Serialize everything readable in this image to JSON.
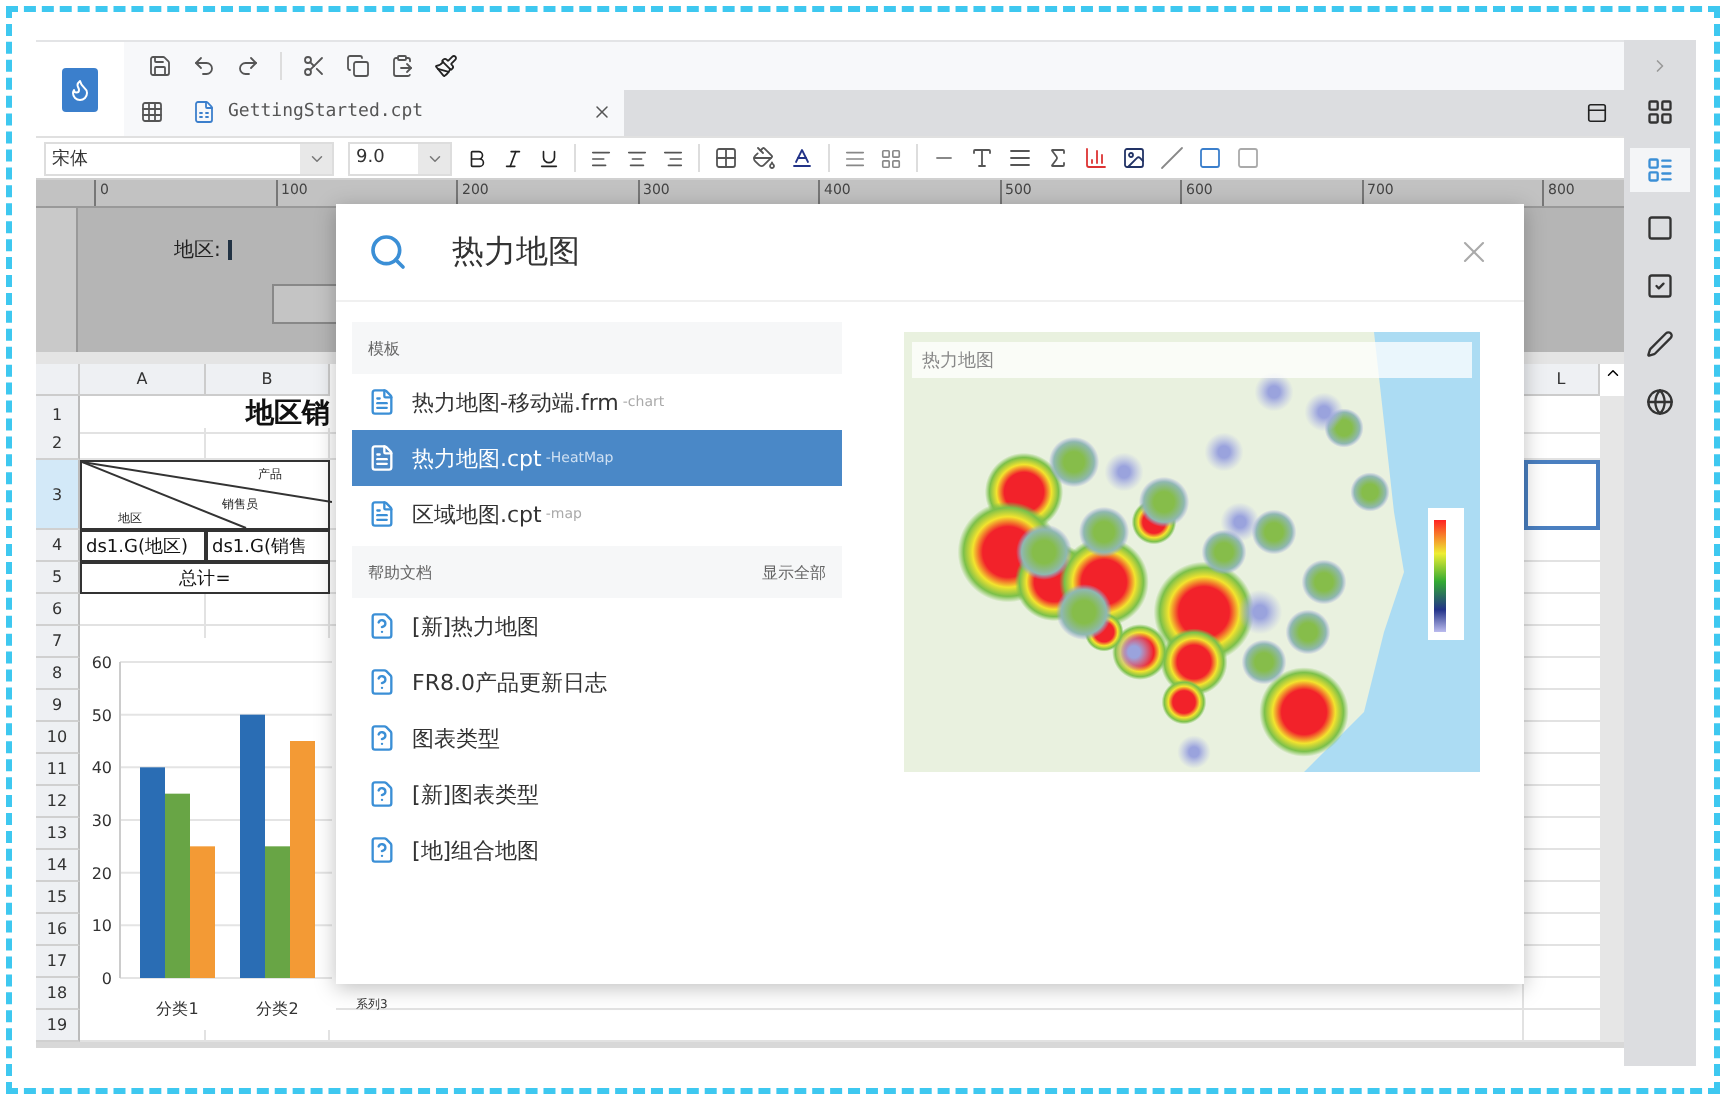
{
  "tab": {
    "title": "GettingStarted.cpt"
  },
  "toolbar": {
    "font": "宋体",
    "size": "9.0"
  },
  "ruler": [
    "0",
    "100",
    "200",
    "300",
    "400",
    "500",
    "600",
    "700",
    "800"
  ],
  "canvas": {
    "label": "地区:"
  },
  "sheet": {
    "columns": [
      "A",
      "B",
      "L"
    ],
    "rows": [
      {
        "number": "1",
        "selected": false,
        "cells": [
          {
            "kind": "title",
            "text": "地区销"
          }
        ]
      },
      {
        "number": "2",
        "selected": false,
        "cells": []
      },
      {
        "number": "3",
        "selected": true,
        "cells": [
          {
            "kind": "diagonal",
            "labels": [
              "产品",
              "销售员",
              "地区"
            ]
          }
        ]
      },
      {
        "number": "4",
        "selected": false,
        "cells": [
          {
            "kind": "field",
            "text": "ds1.G(地区)"
          },
          {
            "kind": "field",
            "text": "ds1.G(销售"
          }
        ]
      },
      {
        "number": "5",
        "selected": false,
        "cells": [
          {
            "kind": "total",
            "text": "总计="
          }
        ]
      },
      {
        "number": "6",
        "selected": false,
        "cells": []
      },
      {
        "number": "7",
        "selected": false,
        "cells": []
      },
      {
        "number": "8",
        "selected": false,
        "cells": []
      },
      {
        "number": "9",
        "selected": false,
        "cells": []
      },
      {
        "number": "10",
        "selected": false,
        "cells": []
      },
      {
        "number": "11",
        "selected": false,
        "cells": []
      },
      {
        "number": "12",
        "selected": false,
        "cells": []
      },
      {
        "number": "13",
        "selected": false,
        "cells": []
      },
      {
        "number": "14",
        "selected": false,
        "cells": []
      },
      {
        "number": "15",
        "selected": false,
        "cells": []
      },
      {
        "number": "16",
        "selected": false,
        "cells": []
      },
      {
        "number": "17",
        "selected": false,
        "cells": []
      },
      {
        "number": "18",
        "selected": false,
        "cells": []
      },
      {
        "number": "19",
        "selected": false,
        "cells": []
      }
    ],
    "chart_data": {
      "type": "bar",
      "categories": [
        "分类1",
        "分类2"
      ],
      "series": [
        {
          "color": "#2a6db4",
          "values": [
            40,
            50
          ]
        },
        {
          "color": "#68a545",
          "values": [
            35,
            25
          ]
        },
        {
          "color": "#f39a35",
          "values": [
            25,
            45
          ]
        }
      ],
      "grid": true,
      "ylim": [
        0,
        60
      ],
      "yticks": [
        0,
        10,
        20,
        30,
        40,
        50,
        60
      ]
    },
    "legend_text": "系列3"
  },
  "dialog": {
    "search": {
      "value": "热力地图"
    },
    "sections": [
      {
        "kind": "template",
        "title": "模板",
        "items": [
          {
            "name": "热力地图-移动端.frm",
            "tag": "-chart",
            "selected": false
          },
          {
            "name": "热力地图.cpt",
            "tag": "-HeatMap",
            "selected": true
          },
          {
            "name": "区域地图.cpt",
            "tag": "-map",
            "selected": false
          }
        ]
      },
      {
        "kind": "help",
        "title": "帮助文档",
        "action": "显示全部",
        "items": [
          {
            "name": "[新]热力地图",
            "selected": false
          },
          {
            "name": "FR8.0产品更新日志",
            "selected": false
          },
          {
            "name": "图表类型",
            "selected": false
          },
          {
            "name": "[新]图表类型",
            "selected": false
          },
          {
            "name": "[地]组合地图",
            "selected": false
          }
        ]
      }
    ],
    "preview": {
      "title": "热力地图"
    }
  },
  "sidebar": {
    "items": [
      {
        "selected": false
      },
      {
        "selected": true
      },
      {
        "selected": false
      },
      {
        "selected": false
      },
      {
        "selected": false
      },
      {
        "selected": false
      }
    ]
  }
}
